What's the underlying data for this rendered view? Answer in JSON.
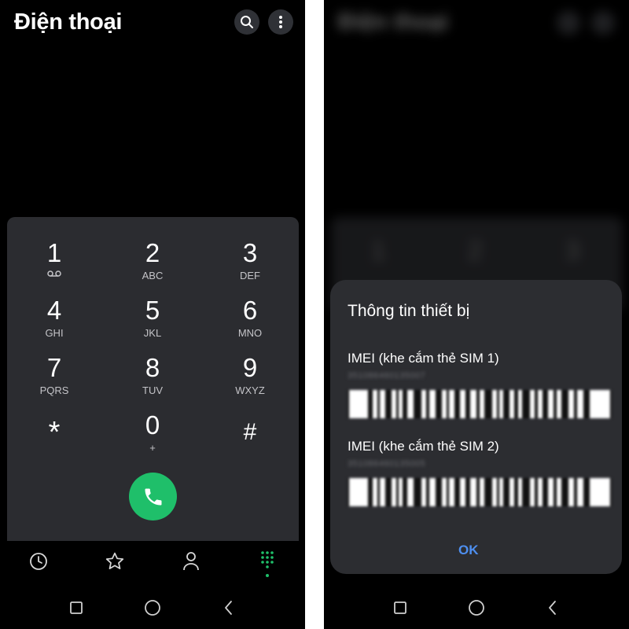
{
  "left": {
    "app_title": "Điện thoại",
    "icons": {
      "search": "search-icon",
      "more": "more-vertical-icon"
    },
    "keys": [
      {
        "num": "1",
        "sub": ""
      },
      {
        "num": "2",
        "sub": "ABC"
      },
      {
        "num": "3",
        "sub": "DEF"
      },
      {
        "num": "4",
        "sub": "GHI"
      },
      {
        "num": "5",
        "sub": "JKL"
      },
      {
        "num": "6",
        "sub": "MNO"
      },
      {
        "num": "7",
        "sub": "PQRS"
      },
      {
        "num": "8",
        "sub": "TUV"
      },
      {
        "num": "9",
        "sub": "WXYZ"
      },
      {
        "num": "*",
        "sub": ""
      },
      {
        "num": "0",
        "sub": "+"
      },
      {
        "num": "#",
        "sub": ""
      }
    ],
    "call_icon": "phone-icon",
    "bottom_nav": [
      "recents-clock-icon",
      "favorites-star-icon",
      "contacts-person-icon",
      "keypad-dots-icon"
    ],
    "active_tab_color": "#1fbf6a",
    "call_color": "#1fbf6a"
  },
  "right": {
    "dialog": {
      "title": "Thông tin thiết bị",
      "sim1_label": "IMEI (khe cắm thẻ SIM 1)",
      "sim1_number": "351086460135007",
      "sim2_label": "IMEI (khe cắm thẻ SIM 2)",
      "sim2_number": "351086460135005",
      "ok_label": "OK"
    },
    "ok_color": "#4e8ff0"
  },
  "system_nav": [
    "recents-square-icon",
    "home-circle-icon",
    "back-chevron-icon"
  ]
}
